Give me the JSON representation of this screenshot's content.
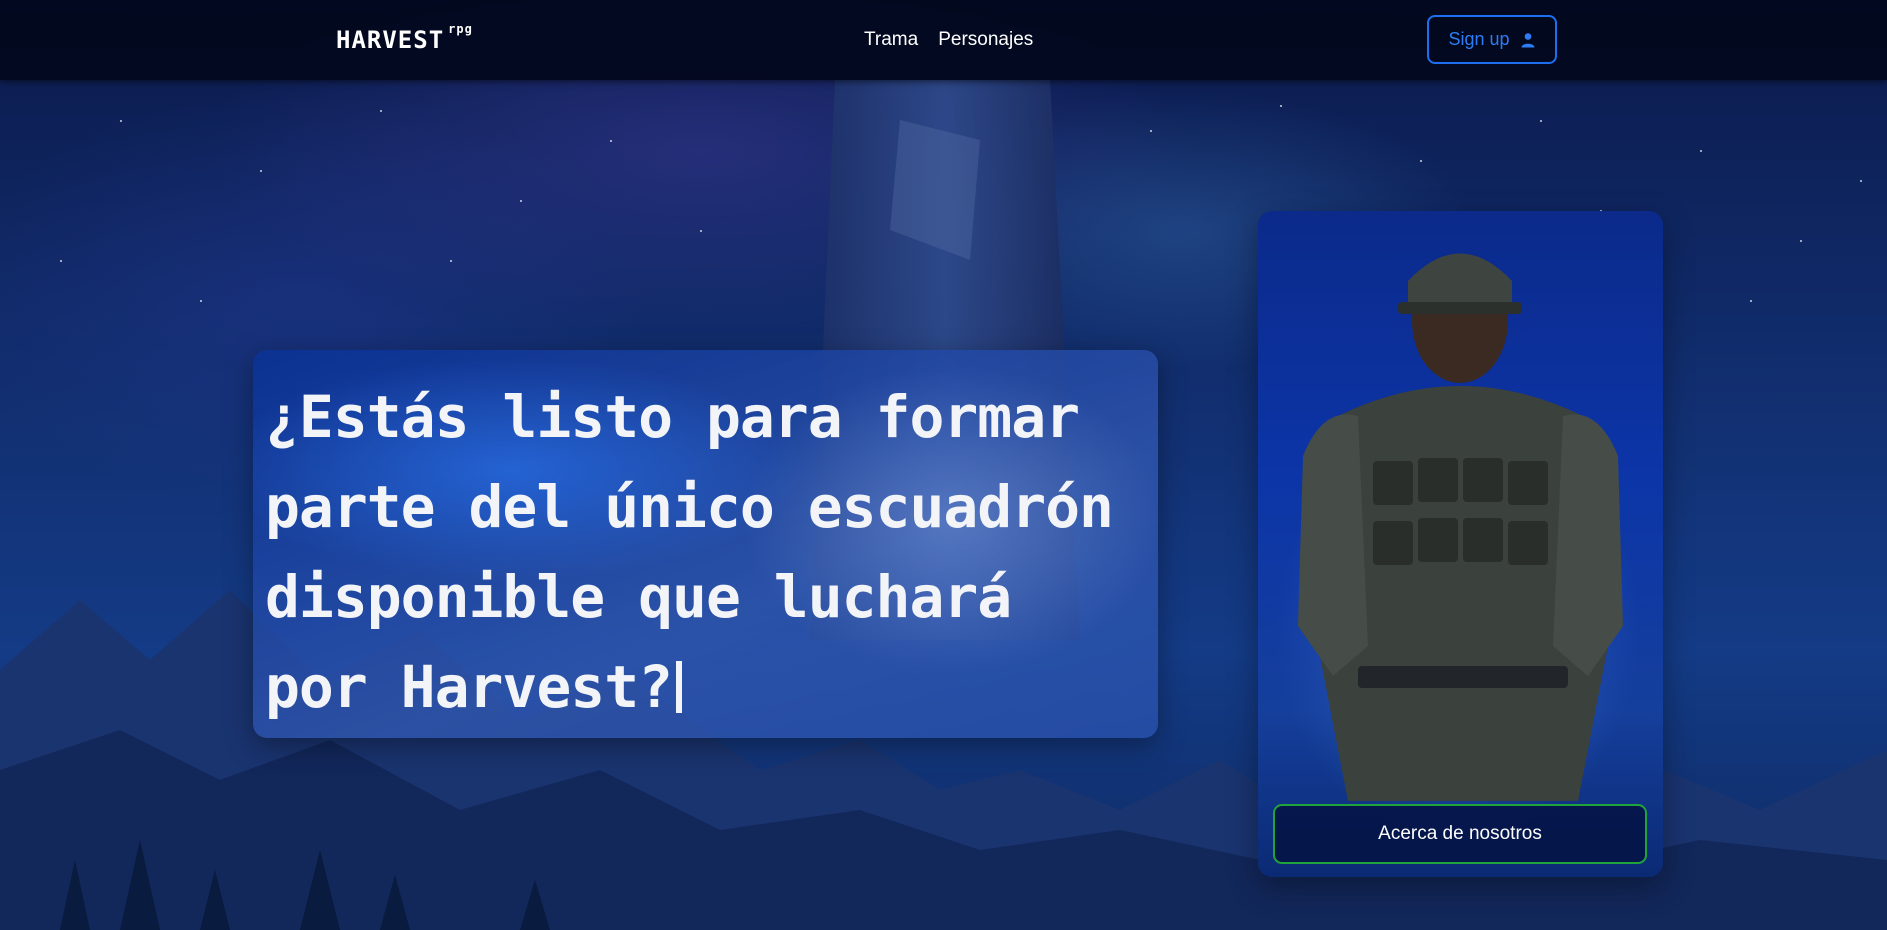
{
  "header": {
    "logo": "HARVEST",
    "logo_sup": "rpg",
    "nav": [
      "Trama",
      "Personajes"
    ],
    "signup_label": "Sign up",
    "signup_icon": "user-icon"
  },
  "hero": {
    "headline": "¿Estás listo para formar parte del único escuadrón disponible que luchará por Harvest?"
  },
  "card": {
    "image": "soldier-image",
    "button_label": "Acerca de nosotros"
  },
  "colors": {
    "accent_blue": "#1e6ff0",
    "accent_green": "#1fa33a",
    "header_bg": "#02081c"
  }
}
